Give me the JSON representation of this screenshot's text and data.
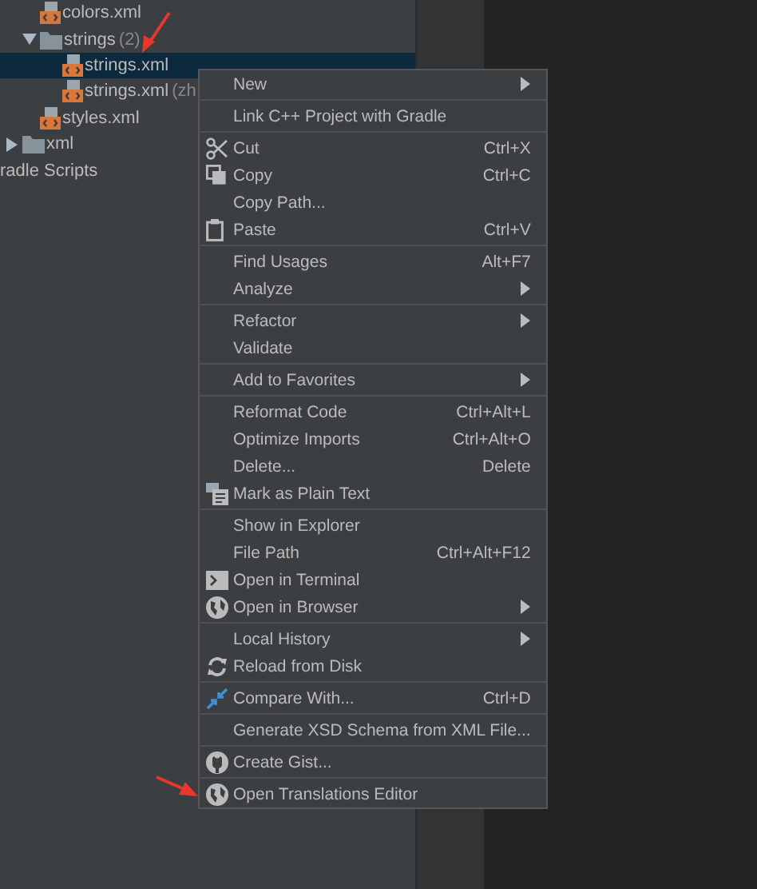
{
  "project_tree": [
    {
      "children": [
        {
          "children": [
            {
              "label": "colors.xml",
              "kind": "file",
              "selected": false
            },
            {
              "label": "strings",
              "hint": "(2)",
              "kind": "folder",
              "expanded": true,
              "selected": false,
              "children": [
                {
                  "label": "strings.xml",
                  "kind": "file",
                  "selected": true
                },
                {
                  "label": "strings.xml",
                  "hint": "(zh",
                  "kind": "file",
                  "selected": false
                }
              ]
            },
            {
              "label": "styles.xml",
              "kind": "file",
              "selected": false
            }
          ]
        },
        {
          "label": "xml",
          "kind": "folder",
          "expanded": false,
          "selected": false
        }
      ]
    },
    {
      "label": "radle Scripts",
      "selected": false
    }
  ],
  "context_menu": [
    [
      {
        "label": "New",
        "submenu": true
      }
    ],
    [
      {
        "label": "Link C++ Project with Gradle"
      }
    ],
    [
      {
        "label": "Cut",
        "shortcut": "Ctrl+X"
      },
      {
        "label": "Copy",
        "shortcut": "Ctrl+C"
      },
      {
        "label": "Copy Path..."
      },
      {
        "label": "Paste",
        "shortcut": "Ctrl+V"
      }
    ],
    [
      {
        "label": "Find Usages",
        "shortcut": "Alt+F7"
      },
      {
        "label": "Analyze",
        "submenu": true
      }
    ],
    [
      {
        "label": "Refactor",
        "submenu": true
      },
      {
        "label": "Validate"
      }
    ],
    [
      {
        "label": "Add to Favorites",
        "submenu": true
      }
    ],
    [
      {
        "label": "Reformat Code",
        "shortcut": "Ctrl+Alt+L"
      },
      {
        "label": "Optimize Imports",
        "shortcut": "Ctrl+Alt+O"
      },
      {
        "label": "Delete...",
        "shortcut": "Delete"
      },
      {
        "label": "Mark as Plain Text"
      }
    ],
    [
      {
        "label": "Show in Explorer"
      },
      {
        "label": "File Path",
        "shortcut": "Ctrl+Alt+F12"
      },
      {
        "label": "Open in Terminal"
      },
      {
        "label": "Open in Browser",
        "submenu": true
      }
    ],
    [
      {
        "label": "Local History",
        "submenu": true
      },
      {
        "label": "Reload from Disk"
      }
    ],
    [
      {
        "label": "Compare With...",
        "shortcut": "Ctrl+D"
      }
    ],
    [
      {
        "label": "Generate XSD Schema from XML File..."
      }
    ],
    [
      {
        "label": "Create Gist..."
      }
    ],
    [
      {
        "label": "Open Translations Editor"
      }
    ]
  ]
}
